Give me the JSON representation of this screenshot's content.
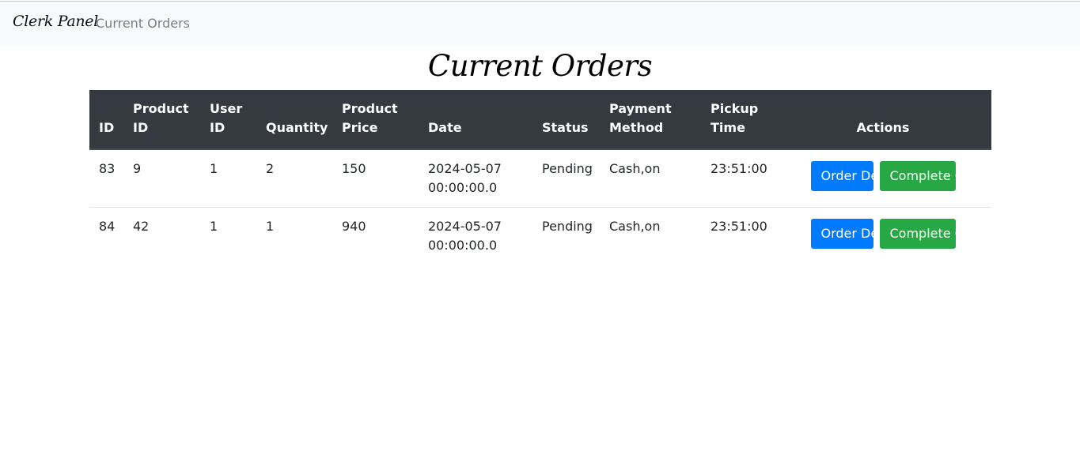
{
  "navbar": {
    "brand": "Clerk Panel",
    "link_current_orders": "Current Orders"
  },
  "page": {
    "title": "Current Orders"
  },
  "table": {
    "headers": {
      "id": "ID",
      "product_id": "Product ID",
      "user_id": "User ID",
      "quantity": "Quantity",
      "product_price": "Product Price",
      "date": "Date",
      "status": "Status",
      "payment_method": "Payment Method",
      "pickup_time": "Pickup Time",
      "actions": "Actions"
    },
    "rows": [
      {
        "id": "83",
        "product_id": "9",
        "user_id": "1",
        "quantity": "2",
        "product_price": "150",
        "date": "2024-05-07 00:00:00.0",
        "status": "Pending",
        "payment_method": "Cash,on",
        "pickup_time": "23:51:00",
        "details_label": "Order Details",
        "complete_label": "Complete Order"
      },
      {
        "id": "84",
        "product_id": "42",
        "user_id": "1",
        "quantity": "1",
        "product_price": "940",
        "date": "2024-05-07 00:00:00.0",
        "status": "Pending",
        "payment_method": "Cash,on",
        "pickup_time": "23:51:00",
        "details_label": "Order Details",
        "complete_label": "Complete Order"
      }
    ]
  },
  "colors": {
    "navbar_bg": "#f8f9fa",
    "table_header_bg": "#343a40",
    "primary": "#007bff",
    "success": "#28a745"
  }
}
